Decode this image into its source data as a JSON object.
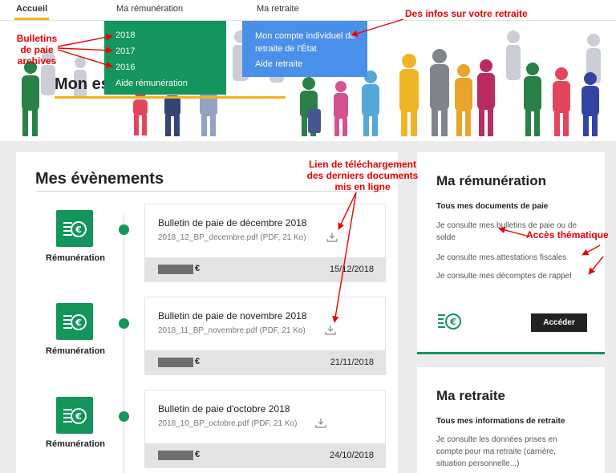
{
  "nav": {
    "accueil": "Accueil",
    "remuneration": "Ma rémunération",
    "retraite": "Ma retraite"
  },
  "banner": {
    "title": "Mon es"
  },
  "dropdown_remuneration": {
    "items": [
      "2018",
      "2017",
      "2016",
      "Aide rémunération"
    ]
  },
  "dropdown_retraite": {
    "items": [
      "Mon compte individuel de retraite de l'État",
      "Aide retraite"
    ]
  },
  "annotations": {
    "bulletins_archives": "Bulletins de paie archives",
    "infos_retraite": "Des infos sur votre retraite",
    "lien_telechargement": "Lien de téléchargement des derniers documents mis en ligne",
    "acces_thematique": "Accès thématique"
  },
  "events": {
    "title": "Mes évènements",
    "items": [
      {
        "category": "Rémunération",
        "title": "Bulletin de paie de décembre 2018",
        "file": "2018_12_BP_decembre.pdf (PDF, 21 Ko)",
        "currency": "€",
        "date": "15/12/2018"
      },
      {
        "category": "Rémunération",
        "title": "Bulletin de paie de novembre 2018",
        "file": "2018_11_BP_novembre.pdf (PDF, 21 Ko)",
        "currency": "€",
        "date": "21/11/2018"
      },
      {
        "category": "Rémunération",
        "title": "Bulletin de paie d'octobre 2018",
        "file": "2018_10_BP_octobre.pdf (PDF, 21 Ko)",
        "currency": "€",
        "date": "24/10/2018"
      }
    ]
  },
  "remuneration_panel": {
    "title": "Ma rémunération",
    "subtitle": "Tous mes documents de paie",
    "links": [
      "Je consulte mes bulletins de paie ou de solde",
      "Je consulte mes attestations fiscales",
      "Je consulte mes décomptes de rappel"
    ],
    "button": "Accéder"
  },
  "retraite_panel": {
    "title": "Ma retraite",
    "subtitle": "Tous mes informations de retraite",
    "text": "Je consulte les données prises en compte pour ma retraite (carrière, situation personnelle...)"
  },
  "colors": {
    "green": "#13955c",
    "blue": "#4a8fe9",
    "accent": "#f3b21a",
    "annotation": "#e00000"
  },
  "icons": [
    "remuneration-euro-icon",
    "download-icon",
    "timeline-dot"
  ]
}
